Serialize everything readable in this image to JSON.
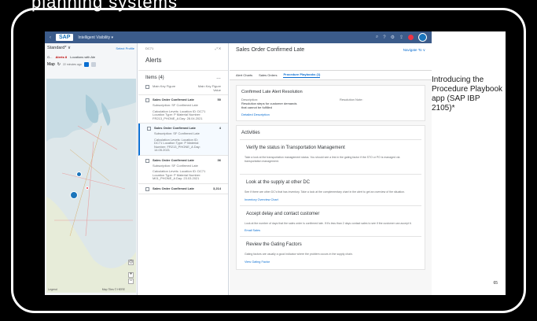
{
  "top_caption": "planning systems",
  "shell": {
    "logo": "SAP",
    "title": "Intelligent Visibility ▾"
  },
  "map_panel": {
    "view": "Standard* ∨",
    "select_profile": "Select Profile",
    "filter_a": "G...",
    "alerts_label": "Alerts 8",
    "locations_label": "Locations with Ale",
    "map_label": "Map",
    "time_label": "22 minutes ago",
    "legend": "Legend",
    "scale": "Map Tiles © HERE"
  },
  "alerts_panel": {
    "context": "DC71",
    "title": "Alerts",
    "items_header": "Items (4)",
    "col_key": "Main Key Figure",
    "col_value": "Main Key Figure Value",
    "items": [
      {
        "name": "Sales Order Confirmed Late",
        "value": "50",
        "sub": "Subscription: SF Confirmed Late",
        "calc": "Calculation Levels: Location ID: DC71  Location Type: P  Material Number: FR213_PHONE_A  Day: 28.04.2021"
      },
      {
        "name": "Sales Order Confirmed Late",
        "value": "4",
        "sub": "Subscription: SF Confirmed Late",
        "calc": "Calculation Levels: Location ID: DC71  Location Type: P  Material Number: FR213_PHONE_A  Day: 14.05.2021"
      },
      {
        "name": "Sales Order Confirmed Late",
        "value": "36",
        "sub": "Subscription: SF Confirmed Late",
        "calc": "Calculation Levels: Location ID: DC71  Location Type: P  Material Number: M01_PHONE_A  Day: 23.03.2021"
      },
      {
        "name": "Sales Order Confirmed Late",
        "value": "3,214",
        "sub": "",
        "calc": ""
      }
    ]
  },
  "detail": {
    "title": "Sales Order Confirmed Late",
    "navigate": "Navigate To ∨",
    "tabs": [
      "Alert Charts",
      "Sales Orders",
      "Procedure Playbooks (1)"
    ],
    "resolution_title": "Confirmed Late Alert Resolution",
    "desc_label": "Description:",
    "desc_text": "Resolution steps for customer demands that cannot be fulfilled",
    "note_label": "Resolution Note:",
    "detailed_link": "Detailed Description",
    "activities_title": "Activities",
    "activities": [
      {
        "title": "Verify the status in Transportation Management",
        "text": "Take a look at the transportation management status. You should see a link in the gating factor if the STO or PO is managed via transportation management.",
        "link": ""
      },
      {
        "title": "Look at the supply at other DC",
        "text": "See if there are other DC's that has inventory. Take a look at the complementary chart in the alert to get an overview of the situation.",
        "link": "Inventory Overview Chart"
      },
      {
        "title": "Accept delay and contact customer",
        "text": "Look at the number of days that the sales order is confirmed late. If it's less than 2 days contact sales to see if the customer can accept it.",
        "link": "Email Sales"
      },
      {
        "title": "Review the Gating Factors",
        "text": "Gating factors are usually a good indicator where the problem occurs in the supply chain.",
        "link": "View Gating Factor"
      }
    ]
  },
  "slide": {
    "text": "Introducing the Procedure Playbook app (SAP IBP 2105)*",
    "page": "65"
  }
}
